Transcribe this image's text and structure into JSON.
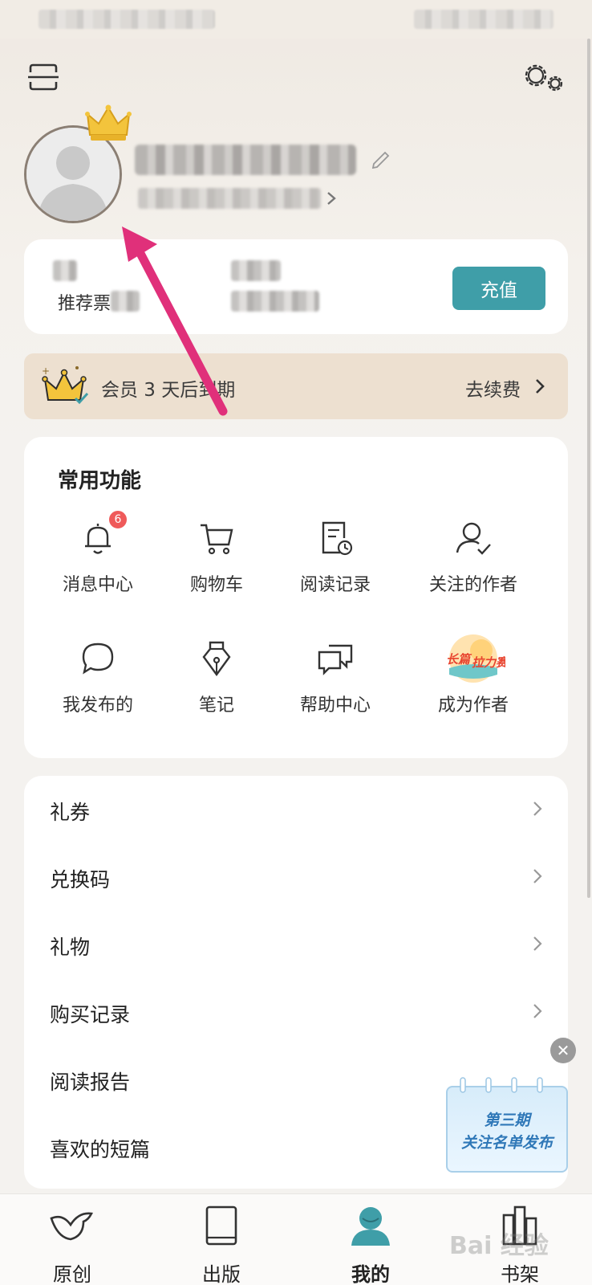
{
  "colors": {
    "accent": "#3f9ea8",
    "vip_banner_bg": "#ede0d0",
    "badge": "#ef5a5a",
    "annotation_arrow": "#e0307a",
    "tab_active_icon": "#3f9ea8"
  },
  "header": {
    "scan_icon": "scan-icon",
    "settings_icon": "settings-gears-icon"
  },
  "profile": {
    "avatar_icon": "default-avatar-icon",
    "crown_icon": "crown-icon",
    "edit_icon": "edit-pencil-icon"
  },
  "wallet": {
    "recommend_ticket_label": "推荐票",
    "recharge_label": "充值"
  },
  "vip": {
    "expire_text": "会员 3 天后到期",
    "renew_label": "去续费"
  },
  "functions": {
    "title": "常用功能",
    "items": [
      {
        "label": "消息中心",
        "icon": "bell-icon",
        "badge": "6"
      },
      {
        "label": "购物车",
        "icon": "cart-icon"
      },
      {
        "label": "阅读记录",
        "icon": "reading-history-icon"
      },
      {
        "label": "关注的作者",
        "icon": "followed-author-icon"
      },
      {
        "label": "我发布的",
        "icon": "chat-bubble-icon"
      },
      {
        "label": "笔记",
        "icon": "pen-nib-icon"
      },
      {
        "label": "帮助中心",
        "icon": "help-chat-icon"
      },
      {
        "label": "成为作者",
        "icon": "contest-badge-icon"
      }
    ]
  },
  "menu_list": [
    {
      "label": "礼券"
    },
    {
      "label": "兑换码"
    },
    {
      "label": "礼物"
    },
    {
      "label": "购买记录"
    },
    {
      "label": "阅读报告"
    },
    {
      "label": "喜欢的短篇"
    }
  ],
  "promo": {
    "line1": "第三期",
    "line2": "关注名单发布",
    "close_icon": "close-icon"
  },
  "tabbar": [
    {
      "label": "原创",
      "icon": "bird-icon"
    },
    {
      "label": "出版",
      "icon": "book-icon"
    },
    {
      "label": "我的",
      "icon": "profile-icon",
      "active": true
    },
    {
      "label": "书架",
      "icon": "bookshelf-icon"
    }
  ],
  "watermark": "Bai 经验"
}
